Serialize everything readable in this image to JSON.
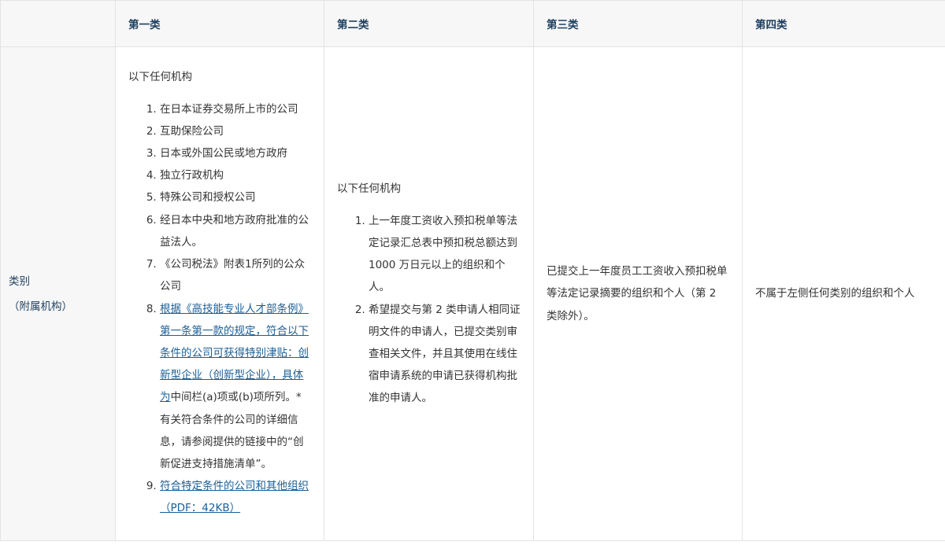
{
  "table": {
    "headers": [
      "",
      "第一类",
      "第二类",
      "第三类",
      "第四类"
    ],
    "row_header": {
      "line1": "类别",
      "line2": "（附属机构）"
    },
    "col1": {
      "intro": "以下任何机构",
      "items": [
        "在日本证券交易所上市的公司",
        "互助保险公司",
        "日本或外国公民或地方政府",
        "独立行政机构",
        "特殊公司和授权公司",
        "经日本中央和地方政府批准的公益法人。",
        "《公司税法》附表1所列的公众公司"
      ],
      "item8_link": "根据《高技能专业人才部条例》第一条第一款的规定，符合以下条件的公司可获得特别津贴：创新型企业（创新型企业），具体为",
      "item8_text": "中间栏(a)项或(b)项所列。*有关符合条件的公司的详细信息，请参阅提供的链接中的“创新促进支持措施清单”。",
      "item9_link": "符合特定条件的公司和其他组织（PDF：42KB）"
    },
    "col2": {
      "intro": "以下任何机构",
      "items": [
        "上一年度工资收入预扣税单等法定记录汇总表中预扣税总额达到 1000 万日元以上的组织和个人。",
        "希望提交与第 2 类申请人相同证明文件的申请人，已提交类别审查相关文件，并且其使用在线住宿申请系统的申请已获得机构批准的申请人。"
      ]
    },
    "col3": {
      "text": "已提交上一年度员工工资收入预扣税单等法定记录摘要的组织和个人（第 2 类除外）。"
    },
    "col4": {
      "text": "不属于左侧任何类别的组织和个人"
    }
  }
}
